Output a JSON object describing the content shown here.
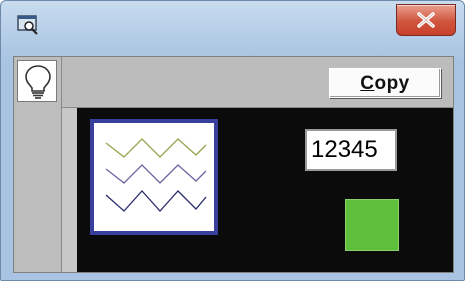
{
  "window": {
    "title": "",
    "icon": "magnifier-window-icon",
    "close_icon": "close-x-icon",
    "colors": {
      "titlebar": "#b7cfe8",
      "close": "#d0553e"
    }
  },
  "toolbar": {
    "bulb_icon": "lightbulb-icon",
    "copy_label_prefix": "C",
    "copy_label_rest": "opy"
  },
  "content": {
    "pattern_icon": "zigzag-pattern-icon",
    "pattern_colors": [
      "#9aa24a",
      "#6f5fa0",
      "#2a2f6e"
    ],
    "number_value": "12345",
    "swatch_color": "#5fbf3a",
    "background_color": "#0b0b0b"
  }
}
